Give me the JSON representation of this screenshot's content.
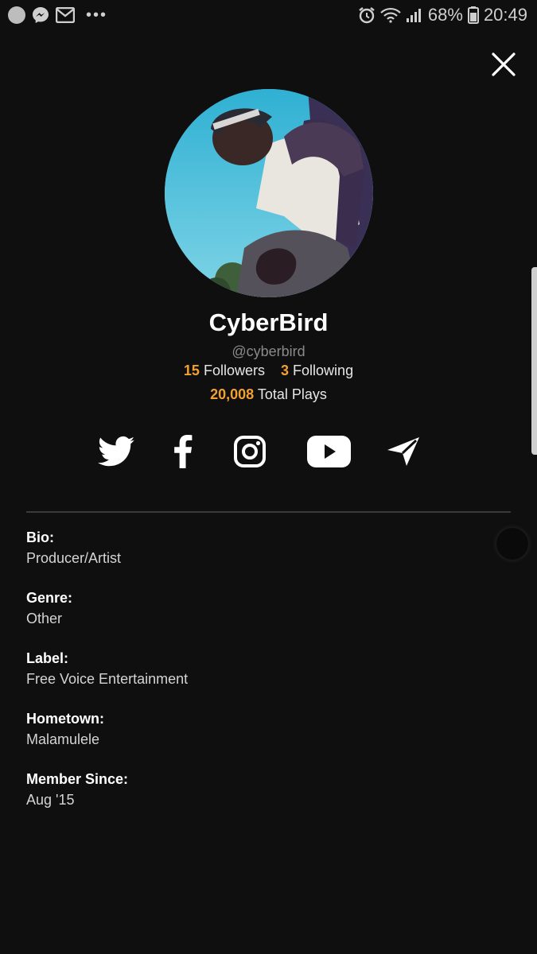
{
  "status_bar": {
    "battery": "68%",
    "time": "20:49",
    "icons": [
      "notification-dot-icon",
      "messenger-icon",
      "gmail-icon",
      "more-icon",
      "alarm-icon",
      "wifi-icon",
      "signal-icon",
      "battery-icon"
    ]
  },
  "profile": {
    "name": "CyberBird",
    "handle": "@cyberbird",
    "followers_count": "15",
    "followers_label": "Followers",
    "following_count": "3",
    "following_label": "Following",
    "plays_count": "20,008",
    "plays_label": "Total Plays"
  },
  "social": [
    "twitter-icon",
    "facebook-icon",
    "instagram-icon",
    "youtube-icon",
    "send-icon"
  ],
  "info": {
    "bio_label": "Bio:",
    "bio_value": "Producer/Artist",
    "genre_label": "Genre:",
    "genre_value": "Other",
    "label_label": "Label:",
    "label_value": "Free Voice Entertainment",
    "hometown_label": "Hometown:",
    "hometown_value": "Malamulele",
    "member_label": "Member Since:",
    "member_value": "Aug '15"
  },
  "colors": {
    "background": "#0f0f0f",
    "accent": "#f2a032",
    "text": "#ffffff",
    "muted": "#8a8a8a"
  }
}
